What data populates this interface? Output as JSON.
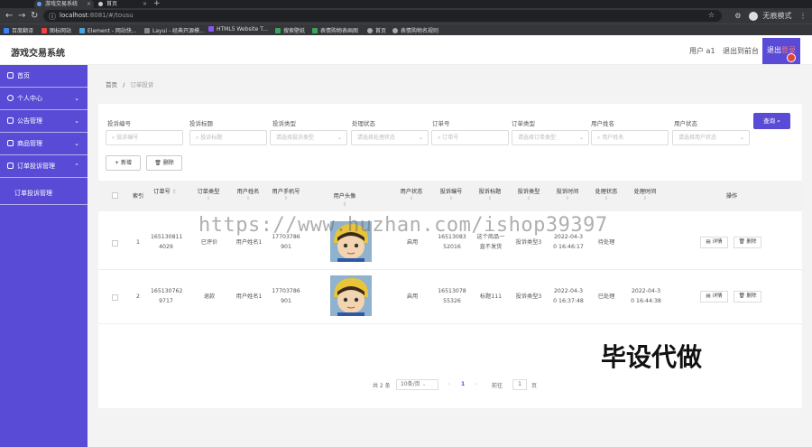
{
  "browser": {
    "tabs": [
      {
        "label": "游戏交易系统"
      },
      {
        "label": "首页"
      }
    ],
    "url_host": "localhost",
    "url_path": ":8081/#/tousu",
    "profile_label": "无痕模式",
    "bookmarks": [
      "百度翻译",
      "图标网站",
      "Element - 网站快...",
      "Layui - 经典开源模...",
      "HTML5 Website T...",
      "搜索壁纸",
      "表情购物表画图",
      "首页",
      "表情购物名规则"
    ]
  },
  "header": {
    "brand": "游戏交易系统",
    "user": "用户 a1",
    "back_front": "退出到前台",
    "logout_a": "退出",
    "logout_b": "登录"
  },
  "sidebar": {
    "items": [
      {
        "label": "首页"
      },
      {
        "label": "个人中心"
      },
      {
        "label": "公告管理"
      },
      {
        "label": "商品管理"
      },
      {
        "label": "订单投诉管理"
      }
    ],
    "sub": "订单投诉管理"
  },
  "breadcrumb": {
    "home": "首页",
    "sep": "/",
    "current": "订单投诉"
  },
  "filters": [
    {
      "label": "投诉编号",
      "placeholder": "投诉编号"
    },
    {
      "label": "投诉标题",
      "placeholder": "投诉标题"
    },
    {
      "label": "投诉类型",
      "placeholder": "请选择投诉类型"
    },
    {
      "label": "处理状态",
      "placeholder": "请选择处理状态"
    },
    {
      "label": "订单号",
      "placeholder": "订单号"
    },
    {
      "label": "订单类型",
      "placeholder": "请选择订单类型"
    },
    {
      "label": "用户姓名",
      "placeholder": "用户姓名"
    },
    {
      "label": "用户状态",
      "placeholder": "请选择用户状态"
    }
  ],
  "actions": {
    "query": "查询",
    "add": "新增",
    "delete": "删除"
  },
  "table": {
    "headers": [
      "索引",
      "订单号",
      "订单类型",
      "用户姓名",
      "用户手机号",
      "用户头像",
      "用户状态",
      "投诉编号",
      "投诉标题",
      "投诉类型",
      "投诉时间",
      "处理状态",
      "处理时间",
      "操作"
    ],
    "rows": [
      {
        "index": "1",
        "order_no": "165130811 4029",
        "order_type": "已评价",
        "user_name": "用户姓名1",
        "phone": "17703786 901",
        "status": "启用",
        "complaint_no": "16513083 52016",
        "title": "这个商品一直不发货",
        "ctype": "投诉类型3",
        "ctime": "2022-04-3 0 16:46:17",
        "pstate": "待处理",
        "ptime": ""
      },
      {
        "index": "2",
        "order_no": "165130762 9717",
        "order_type": "退款",
        "user_name": "用户姓名1",
        "phone": "17703786 901",
        "status": "启用",
        "complaint_no": "16513078 55326",
        "title": "标题111",
        "ctype": "投诉类型3",
        "ctime": "2022-04-3 0 16:37:48",
        "pstate": "已处理",
        "ptime": "2022-04-3 0 16:44:38"
      }
    ],
    "op_detail": "详情",
    "op_delete": "删除"
  },
  "pager": {
    "total": "共 2 条",
    "size": "10条/页",
    "prev": "‹",
    "page": "1",
    "next": "›",
    "goto": "前往",
    "goto_val": "1",
    "page_unit": "页"
  },
  "watermark": "https://www.huzhan.com/ishop39397",
  "overlay": "毕设代做",
  "colors": {
    "primary": "#5a4bd6",
    "accent": "#e0463c"
  }
}
